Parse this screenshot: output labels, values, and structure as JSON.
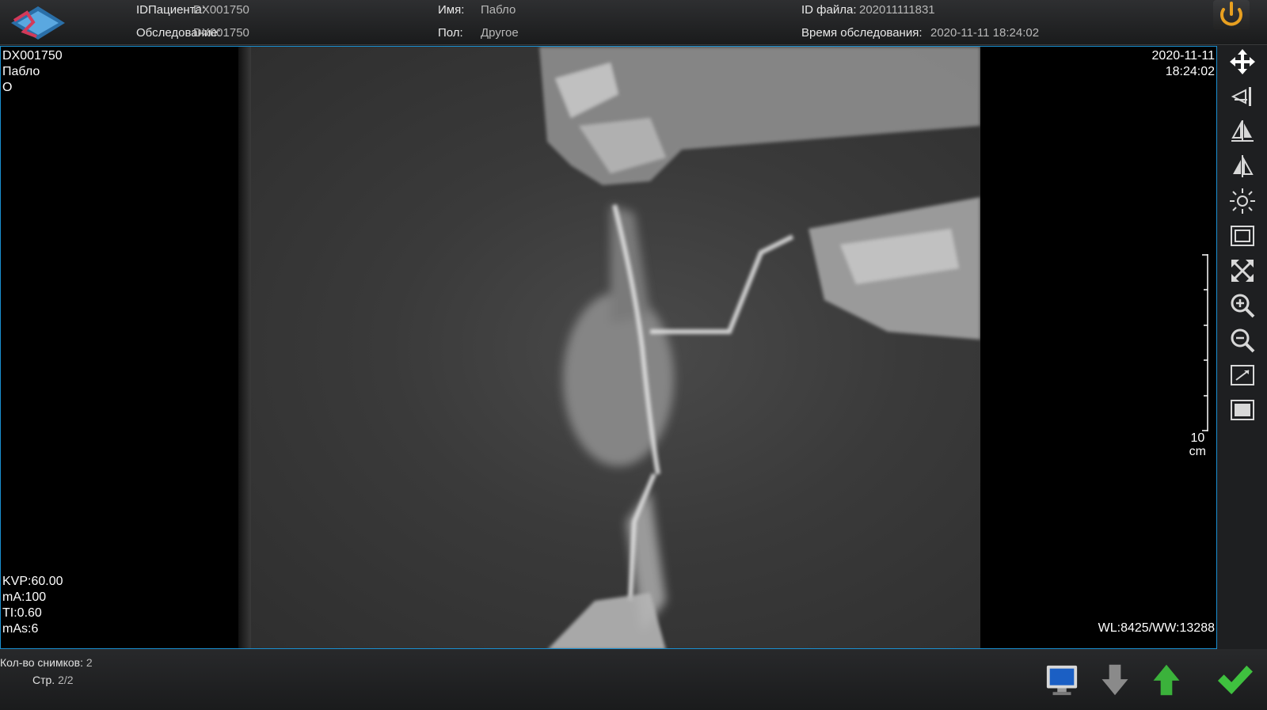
{
  "header": {
    "patient_id_label": "IDПациента:",
    "patient_id_value": "DX001750",
    "exam_label": "Обследование:",
    "exam_value": "DX001750",
    "name_label": "Имя:",
    "name_value": "Пабло",
    "sex_label": "Пол:",
    "sex_value": "Другое",
    "file_id_label": "ID файла:",
    "file_id_value": "202011111831",
    "exam_time_label": "Время обследования:",
    "exam_time_value": "2020-11-11 18:24:02"
  },
  "overlay": {
    "top_left": [
      "DX001750",
      "Пабло",
      "O"
    ],
    "top_right": [
      "2020-11-11",
      "18:24:02"
    ],
    "bottom_left": [
      "KVP:60.00",
      "mA:100",
      "TI:0.60",
      "mAs:6"
    ],
    "bottom_right": "WL:8425/WW:13288",
    "scale_value": "10",
    "scale_unit": "cm"
  },
  "toolbar": {
    "tools": [
      "move-icon",
      "rotate-icon",
      "flip-vertical-icon",
      "flip-horizontal-icon",
      "brightness-icon",
      "crop-icon",
      "fit-window-icon",
      "zoom-in-icon",
      "zoom-out-icon",
      "original-size-icon",
      "fullscreen-icon"
    ]
  },
  "footer": {
    "count_label": "Кол-во снимков:",
    "count_value": "2",
    "page_label": "Стр.",
    "page_value": "2/2"
  },
  "colors": {
    "accent_border": "#1a8fd0",
    "power": "#e8a020",
    "up_arrow": "#3bb23b",
    "check": "#3fc13f"
  }
}
